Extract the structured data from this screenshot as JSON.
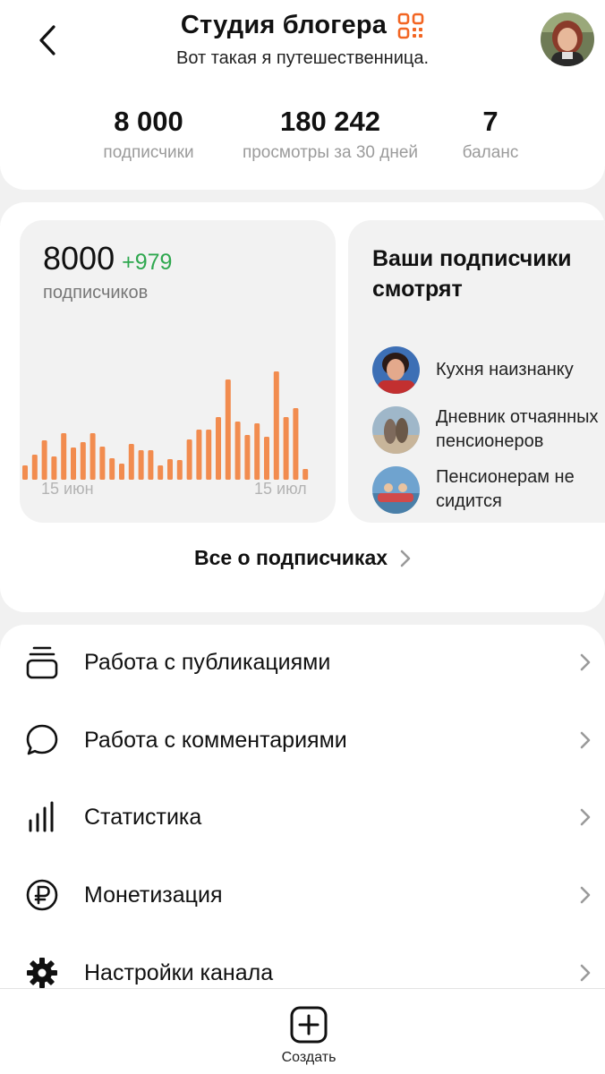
{
  "header": {
    "title": "Студия блогера",
    "subtitle": "Вот такая я путешественница.",
    "back_icon": "chevron-left-icon",
    "qr_icon": "qr-code-icon",
    "accent_color": "#f26522"
  },
  "stats": [
    {
      "value": "8 000",
      "label": "подписчики"
    },
    {
      "value": "180 242",
      "label": "просмотры за 30 дней"
    },
    {
      "value": "7",
      "label": "баланс"
    }
  ],
  "subscribers_chart": {
    "count": "8000",
    "delta": "+979",
    "label": "подписчиков",
    "x_start_label": "15 июн",
    "x_end_label": "15 июл"
  },
  "chart_data": {
    "type": "bar",
    "color": "#f28c4f",
    "xlabel": "",
    "ylabel": "",
    "x_tick_labels": [
      "15 июн",
      "15 июл"
    ],
    "values": [
      16,
      28,
      44,
      26,
      52,
      36,
      42,
      52,
      37,
      24,
      18,
      40,
      33,
      33,
      16,
      23,
      22,
      45,
      56,
      56,
      70,
      112,
      65,
      50,
      63,
      48,
      121,
      70,
      80,
      12
    ]
  },
  "watching": {
    "title": "Ваши подписчики смотрят",
    "items": [
      {
        "name": "Кухня наизнанку"
      },
      {
        "name": "Дневник отчаянных\nпенсионеров"
      },
      {
        "name": "Пенсионерам не\nсидится"
      }
    ]
  },
  "all_subscribers": {
    "label": "Все о подписчиках"
  },
  "menu": [
    {
      "label": "Работа с публикациями",
      "icon": "publications-stack-icon"
    },
    {
      "label": "Работа с комментариями",
      "icon": "comment-bubble-icon"
    },
    {
      "label": "Статистика",
      "icon": "statistics-bars-icon"
    },
    {
      "label": "Монетизация",
      "icon": "ruble-icon"
    },
    {
      "label": "Настройки канала",
      "icon": "gear-icon"
    }
  ],
  "bottom": {
    "create_label": "Создать",
    "create_icon": "plus-square-icon"
  }
}
